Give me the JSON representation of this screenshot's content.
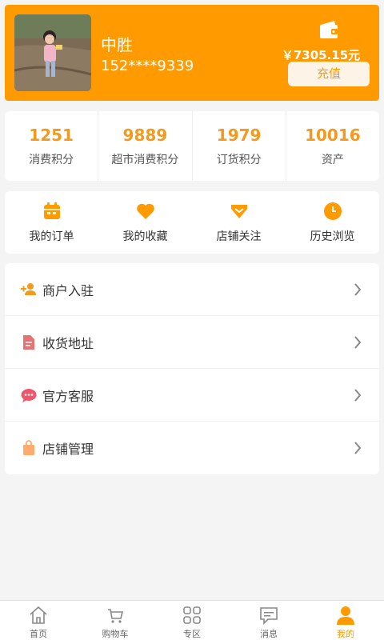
{
  "profile": {
    "username": "中胜",
    "phone": "152****9339",
    "balance": "￥7305.15元",
    "recharge_label": "充值"
  },
  "stats": [
    {
      "value": "1251",
      "label": "消费积分"
    },
    {
      "value": "9889",
      "label": "超市消费积分"
    },
    {
      "value": "1979",
      "label": "订货积分"
    },
    {
      "value": "10016",
      "label": "资产"
    }
  ],
  "shortcuts": [
    {
      "label": "我的订单",
      "icon": "calendar-icon"
    },
    {
      "label": "我的收藏",
      "icon": "heart-icon"
    },
    {
      "label": "店铺关注",
      "icon": "diamond-icon"
    },
    {
      "label": "历史浏览",
      "icon": "clock-icon"
    }
  ],
  "menu": [
    {
      "label": "商户入驻",
      "icon": "add-user-icon",
      "color": "#f39a1e"
    },
    {
      "label": "收货地址",
      "icon": "document-icon",
      "color": "#e57373"
    },
    {
      "label": "官方客服",
      "icon": "chat-bubble-icon",
      "color": "#f0566b"
    },
    {
      "label": "店铺管理",
      "icon": "shopping-bag-icon",
      "color": "#ffab70"
    }
  ],
  "tabs": [
    {
      "label": "首页",
      "icon": "home-icon"
    },
    {
      "label": "购物车",
      "icon": "cart-icon"
    },
    {
      "label": "专区",
      "icon": "grid-icon"
    },
    {
      "label": "消息",
      "icon": "message-icon"
    },
    {
      "label": "我的",
      "icon": "user-icon",
      "active": true
    }
  ],
  "colors": {
    "accent": "#ff9a00",
    "stat_value": "#f39a1e",
    "background": "#f4f4f4"
  }
}
